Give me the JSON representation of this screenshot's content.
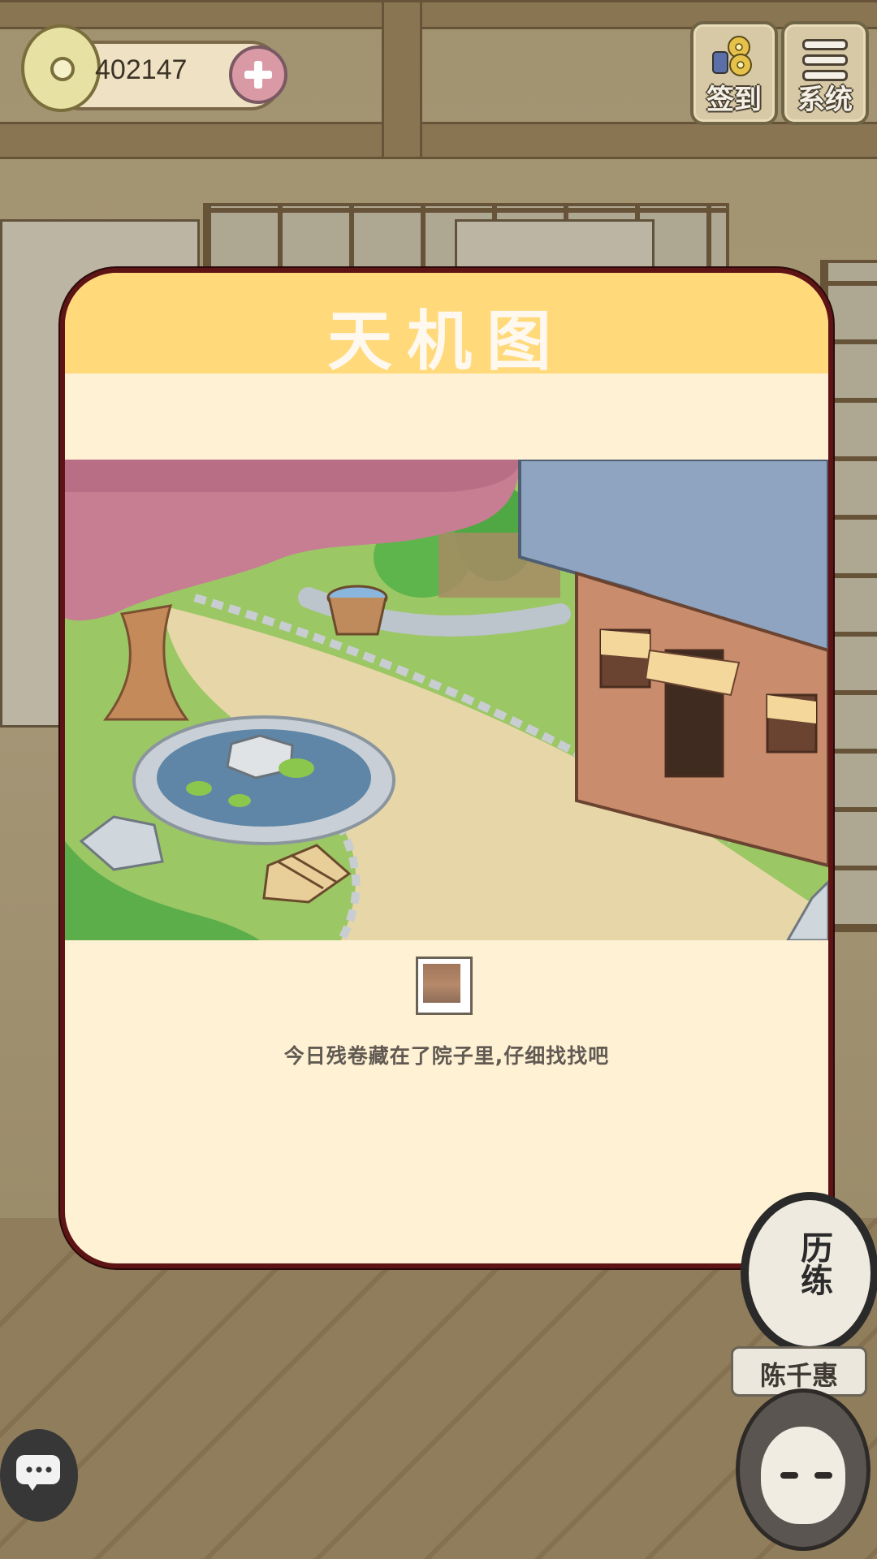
{
  "hud": {
    "coins": "402147",
    "signin_label": "签到",
    "system_label": "系统"
  },
  "modal": {
    "title": "天机图",
    "hint": "今日残卷藏在了院子里,仔细找找吧"
  },
  "side": {
    "practice_label": "历练",
    "character_name": "陈千惠"
  },
  "icons": {
    "coin": "coin-icon",
    "add": "plus-icon",
    "signin": "coins-icon",
    "system": "menu-icon",
    "chat": "chat-icon"
  },
  "colors": {
    "modal_header": "#ffd97a",
    "modal_body": "#fff1d4",
    "modal_border": "#5e1414",
    "plus_button": "#d99aa6"
  }
}
